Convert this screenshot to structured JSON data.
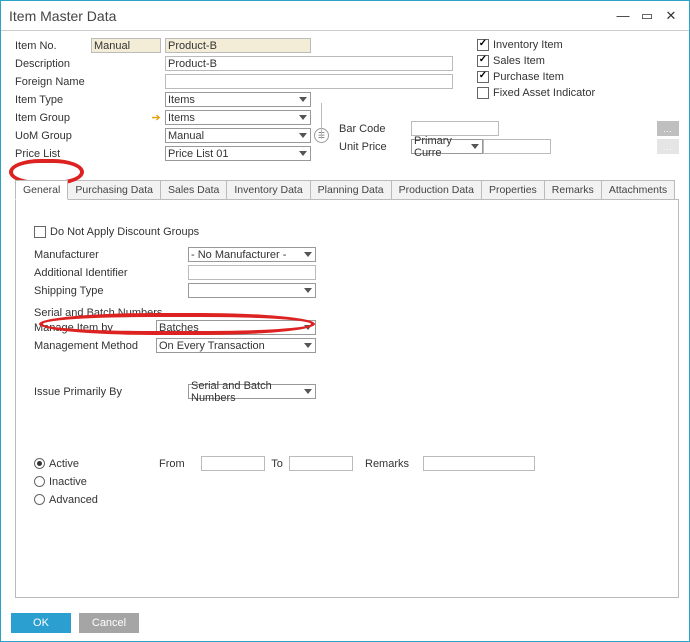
{
  "window": {
    "title": "Item Master Data"
  },
  "header": {
    "item_no_label": "Item No.",
    "item_no_mode": "Manual",
    "item_no_value": "Product-B",
    "description_label": "Description",
    "description_value": "Product-B",
    "foreign_name_label": "Foreign Name",
    "foreign_name_value": "",
    "item_type_label": "Item Type",
    "item_type_value": "Items",
    "item_group_label": "Item Group",
    "item_group_value": "Items",
    "uom_group_label": "UoM Group",
    "uom_group_value": "Manual",
    "price_list_label": "Price List",
    "price_list_value": "Price List 01",
    "barcode_label": "Bar Code",
    "barcode_value": "",
    "unit_price_label": "Unit Price",
    "unit_price_currency": "Primary Curre",
    "unit_price_value": ""
  },
  "flags": {
    "inventory_item": "Inventory Item",
    "sales_item": "Sales Item",
    "purchase_item": "Purchase Item",
    "fixed_asset": "Fixed Asset Indicator"
  },
  "tabs": [
    "General",
    "Purchasing Data",
    "Sales Data",
    "Inventory Data",
    "Planning Data",
    "Production Data",
    "Properties",
    "Remarks",
    "Attachments"
  ],
  "general": {
    "do_not_discount": "Do Not Apply Discount Groups",
    "manufacturer_label": "Manufacturer",
    "manufacturer_value": "- No Manufacturer -",
    "additional_id_label": "Additional Identifier",
    "additional_id_value": "",
    "shipping_type_label": "Shipping Type",
    "shipping_type_value": "",
    "serial_batch_head": "Serial and Batch Numbers",
    "manage_item_by_label": "Manage Item by",
    "manage_item_by_value": "Batches",
    "mgmt_method_label": "Management Method",
    "mgmt_method_value": "On Every Transaction",
    "issue_primarily_label": "Issue Primarily By",
    "issue_primarily_value": "Serial and Batch Numbers",
    "status": {
      "active": "Active",
      "inactive": "Inactive",
      "advanced": "Advanced",
      "from": "From",
      "to": "To",
      "remarks": "Remarks"
    }
  },
  "buttons": {
    "ok": "OK",
    "cancel": "Cancel"
  }
}
